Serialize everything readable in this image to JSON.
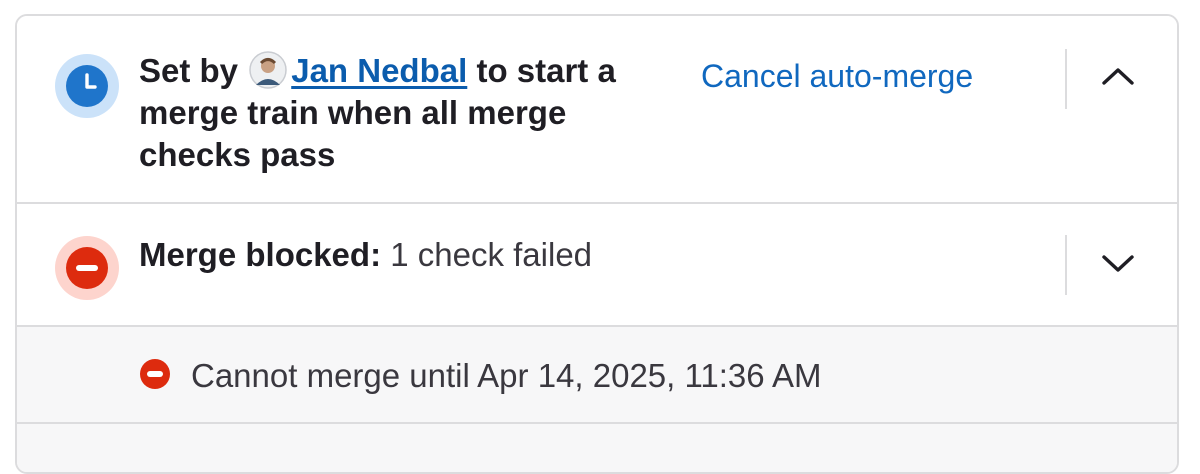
{
  "auto_merge": {
    "icon": "clock-icon",
    "prefix": "Set by",
    "author_name": "Jan Nedbal",
    "suffix": "to start a merge train when all merge checks pass",
    "cancel_label": "Cancel auto-merge",
    "toggle_icon": "chevron-up-icon",
    "accent_color": "#1f75cb"
  },
  "merge_blocked": {
    "icon": "status-failed-icon",
    "title": "Merge blocked:",
    "detail": "1 check failed",
    "toggle_icon": "chevron-down-icon",
    "accent_color": "#dd2b0e"
  },
  "checks": [
    {
      "icon": "status-failed-icon",
      "text": "Cannot merge until Apr 14, 2025, 11:36 AM"
    }
  ]
}
